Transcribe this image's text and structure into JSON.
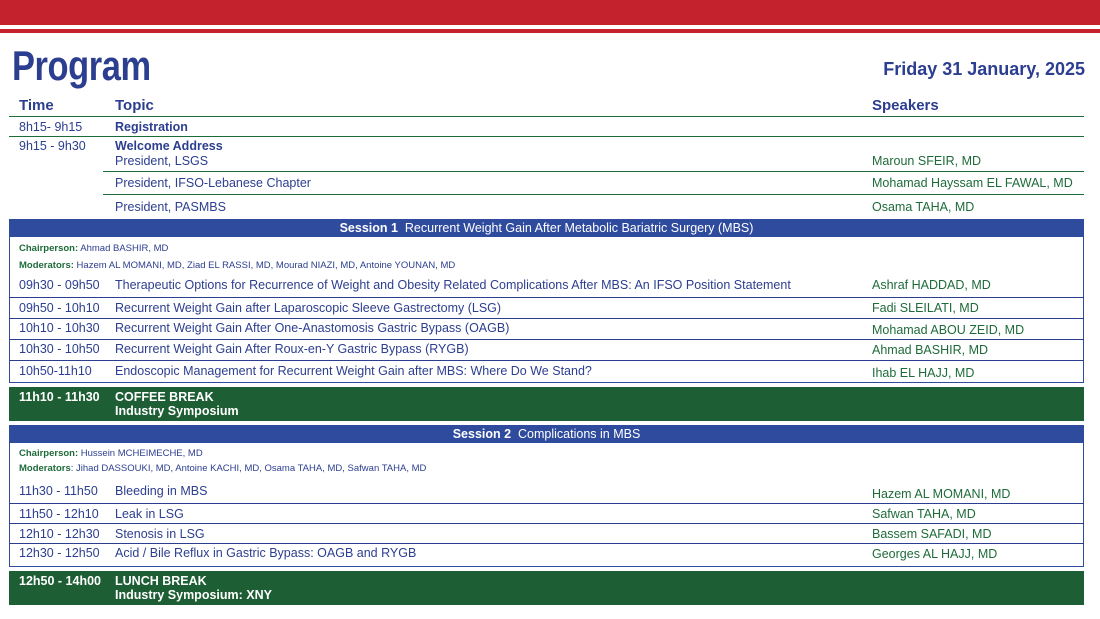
{
  "header": {
    "title": "Program",
    "date": "Friday 31 January, 2025"
  },
  "columns": {
    "time": "Time",
    "topic": "Topic",
    "speakers": "Speakers"
  },
  "opening": {
    "registration": {
      "time": "8h15- 9h15",
      "topic": "Registration"
    },
    "welcome": {
      "time": "9h15 - 9h30",
      "topic": "Welcome Address",
      "items": [
        {
          "topic": "President, LSGS",
          "speaker": "Maroun SFEIR, MD"
        },
        {
          "topic": "President, IFSO-Lebanese Chapter",
          "speaker": "Mohamad Hayssam EL FAWAL, MD"
        },
        {
          "topic": "President, PASMBS",
          "speaker": "Osama TAHA, MD"
        }
      ]
    }
  },
  "session1": {
    "label": "Session 1",
    "title": "Recurrent Weight Gain After Metabolic Bariatric Surgery (MBS)",
    "chair_label": "Chairperson:",
    "chair": "Ahmad BASHIR, MD",
    "mod_label": "Moderators:",
    "moderators": "Hazem AL MOMANI, MD, Ziad EL RASSI, MD, Mourad NIAZI, MD, Antoine YOUNAN, MD",
    "rows": [
      {
        "time": "09h30 - 09h50",
        "topic": "Therapeutic Options for Recurrence of Weight and Obesity Related Complications After MBS: An IFSO Position Statement",
        "speaker": "Ashraf HADDAD, MD"
      },
      {
        "time": "09h50 - 10h10",
        "topic": "Recurrent Weight Gain after Laparoscopic Sleeve Gastrectomy (LSG)",
        "speaker": "Fadi SLEILATI, MD"
      },
      {
        "time": "10h10 - 10h30",
        "topic": "Recurrent Weight Gain After One-Anastomosis Gastric Bypass (OAGB)",
        "speaker": "Mohamad ABOU ZEID, MD"
      },
      {
        "time": "10h30 - 10h50",
        "topic": "Recurrent Weight Gain After Roux-en-Y Gastric Bypass (RYGB)",
        "speaker": "Ahmad BASHIR, MD"
      },
      {
        "time": "10h50-11h10",
        "topic": "Endoscopic Management for Recurrent Weight Gain after MBS: Where Do We Stand?",
        "speaker": "Ihab EL HAJJ, MD"
      }
    ]
  },
  "break1": {
    "time": "11h10 - 11h30",
    "title": "COFFEE BREAK",
    "subtitle": "Industry Symposium"
  },
  "session2": {
    "label": "Session 2",
    "title": "Complications in MBS",
    "chair_label": "Chairperson:",
    "chair": "Hussein MCHEIMECHE, MD",
    "mod_label": "Moderators",
    "moderators": ": Jihad DASSOUKI, MD, Antoine KACHI, MD, Osama TAHA, MD, Safwan TAHA, MD",
    "rows": [
      {
        "time": "11h30 - 11h50",
        "topic": "Bleeding in MBS",
        "speaker": "Hazem AL MOMANI, MD"
      },
      {
        "time": "11h50 - 12h10",
        "topic": "Leak in LSG",
        "speaker": "Safwan TAHA, MD"
      },
      {
        "time": "12h10 - 12h30",
        "topic": "Stenosis in LSG",
        "speaker": "Bassem SAFADI, MD"
      },
      {
        "time": "12h30 - 12h50",
        "topic": "Acid / Bile Reflux in Gastric Bypass: OAGB and RYGB",
        "speaker": "Georges AL HAJJ, MD"
      }
    ]
  },
  "break2": {
    "time": "12h50 - 14h00",
    "title": "LUNCH BREAK",
    "subtitle": "Industry Symposium: XNY"
  }
}
